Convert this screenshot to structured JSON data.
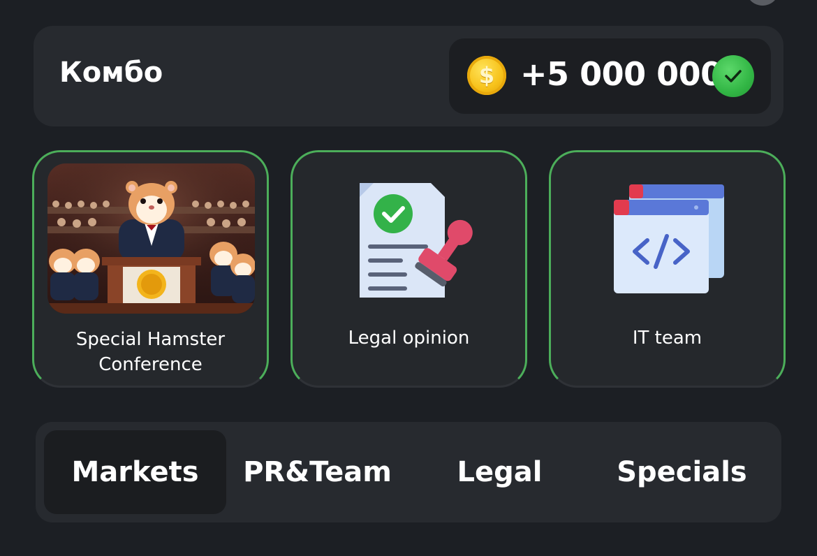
{
  "combo": {
    "title": "Комбо",
    "reward": "+5 000 000",
    "coin_icon": "coin-icon",
    "status_icon": "checkmark-icon"
  },
  "cards": [
    {
      "label": "Special Hamster Conference",
      "icon": "hamster-conference-image"
    },
    {
      "label": "Legal opinion",
      "icon": "legal-document-stamp-icon"
    },
    {
      "label": "IT team",
      "icon": "code-window-icon"
    }
  ],
  "tabs": [
    {
      "label": "Markets",
      "active": true
    },
    {
      "label": "PR&Team",
      "active": false
    },
    {
      "label": "Legal",
      "active": false
    },
    {
      "label": "Specials",
      "active": false
    }
  ],
  "colors": {
    "background": "#1c1f24",
    "panel": "#272a2f",
    "accent_green": "#4cae5a",
    "coin_gold": "#f7c21a"
  }
}
